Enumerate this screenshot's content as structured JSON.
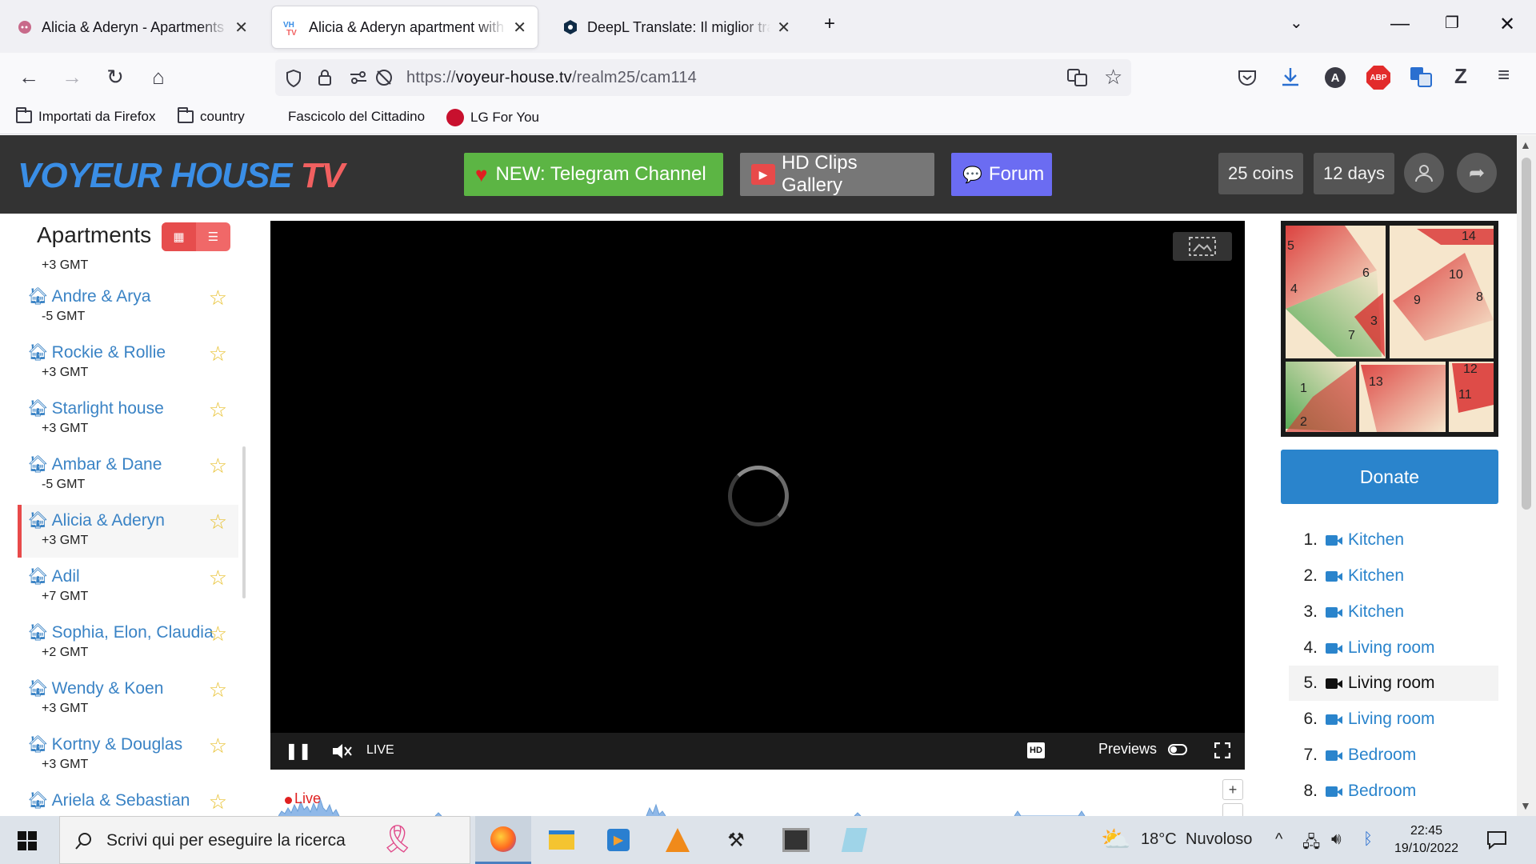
{
  "browser": {
    "tabs": [
      {
        "title": "Alicia & Aderyn - Apartments D",
        "active": false
      },
      {
        "title": "Alicia & Aderyn apartment with",
        "active": true
      },
      {
        "title": "DeepL Translate: Il miglior tradu",
        "active": false
      }
    ],
    "url_prefix": "https://",
    "url_domain": "voyeur-house.tv",
    "url_path": "/realm25/cam114",
    "bookmarks": [
      "Importati da Firefox",
      "country",
      "Fascicolo del Cittadino",
      "LG For You"
    ],
    "extensions": {
      "abp_label": "ABP",
      "account_letter": "A",
      "z_label": "Z"
    }
  },
  "site": {
    "logo_main": "VOYEUR HOUSE",
    "logo_tv": "TV",
    "telegram_label": "NEW: Telegram Channel",
    "clips_label": "HD Clips Gallery",
    "forum_label": "Forum",
    "coins": "25 coins",
    "days": "12 days"
  },
  "sidebar": {
    "title": "Apartments",
    "partial_tz": "+3 GMT",
    "apartments": [
      {
        "name": "Andre & Arya",
        "tz": "-5 GMT"
      },
      {
        "name": "Rockie & Rollie",
        "tz": "+3 GMT"
      },
      {
        "name": "Starlight house",
        "tz": "+3 GMT"
      },
      {
        "name": "Ambar & Dane",
        "tz": "-5 GMT"
      },
      {
        "name": "Alicia & Aderyn",
        "tz": "+3 GMT"
      },
      {
        "name": "Adil",
        "tz": "+7 GMT"
      },
      {
        "name": "Sophia, Elon, Claudia",
        "tz": "+2 GMT"
      },
      {
        "name": "Wendy & Koen",
        "tz": "+3 GMT"
      },
      {
        "name": "Kortny & Douglas",
        "tz": "+3 GMT"
      },
      {
        "name": "Ariela & Sebastian",
        "tz": ""
      }
    ]
  },
  "player": {
    "live_label": "LIVE",
    "hd_label": "HD",
    "previews_label": "Previews",
    "timeline_live": "Live"
  },
  "floorplan": {
    "room_numbers": [
      "1",
      "2",
      "3",
      "4",
      "5",
      "6",
      "7",
      "8",
      "9",
      "10",
      "11",
      "12",
      "13",
      "14"
    ]
  },
  "donate_label": "Donate",
  "cameras": [
    {
      "n": "1.",
      "label": "Kitchen"
    },
    {
      "n": "2.",
      "label": "Kitchen"
    },
    {
      "n": "3.",
      "label": "Kitchen"
    },
    {
      "n": "4.",
      "label": "Living room"
    },
    {
      "n": "5.",
      "label": "Living room"
    },
    {
      "n": "6.",
      "label": "Living room"
    },
    {
      "n": "7.",
      "label": "Bedroom"
    },
    {
      "n": "8.",
      "label": "Bedroom"
    }
  ],
  "taskbar": {
    "search_placeholder": "Scrivi qui per eseguire la ricerca",
    "weather_temp": "18°C",
    "weather_desc": "Nuvoloso",
    "time": "22:45",
    "date": "19/10/2022"
  },
  "colors": {
    "accent_blue": "#2a84cc",
    "telegram_green": "#5cb544",
    "forum_purple": "#6b6cf2",
    "active_red": "#e84a4a"
  }
}
